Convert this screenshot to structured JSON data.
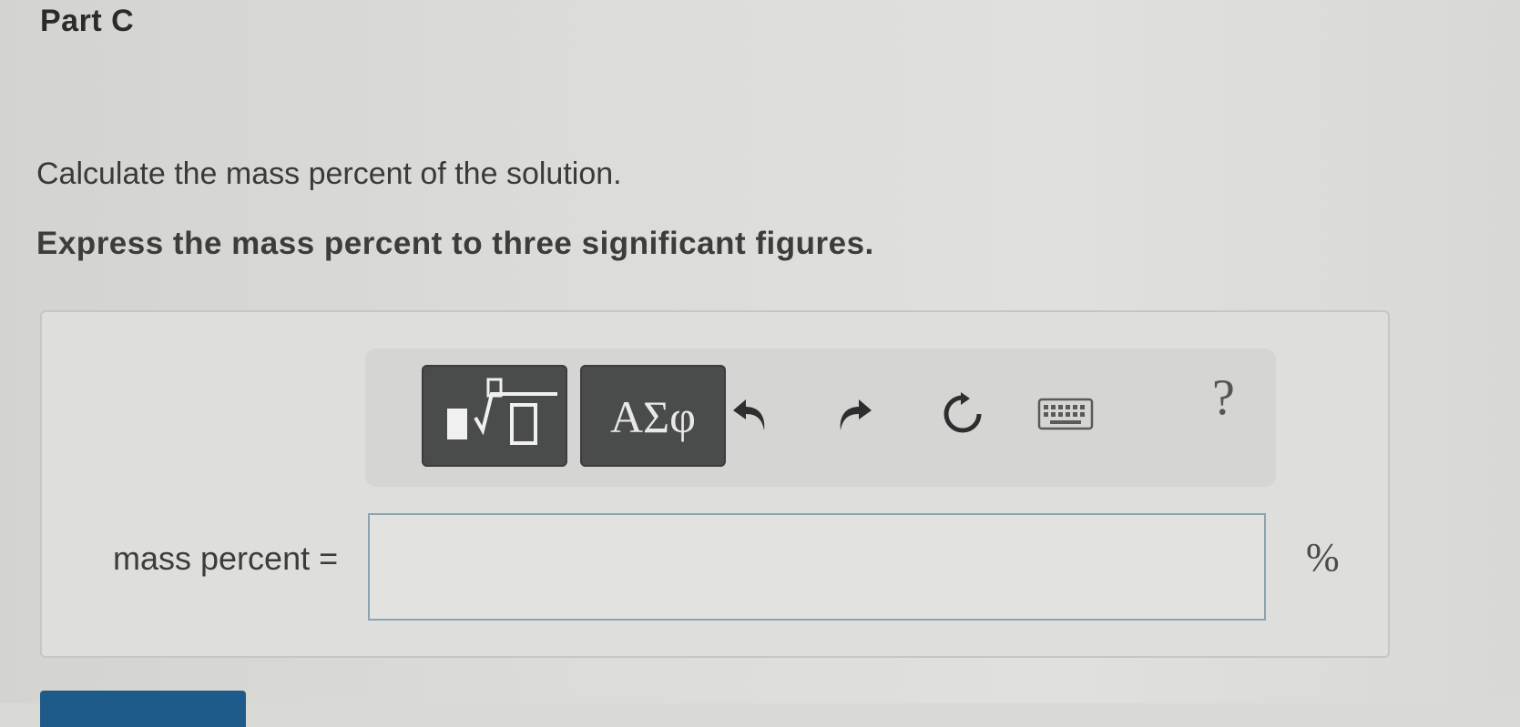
{
  "part": {
    "title": "Part C"
  },
  "question": {
    "instruction": "Calculate the mass percent of the solution.",
    "precision_note": "Express the mass percent to three significant figures."
  },
  "toolbar": {
    "greek_label": "ΑΣφ",
    "help_label": "?",
    "icons": [
      "templates-icon",
      "greek-letters-icon",
      "undo-icon",
      "redo-icon",
      "reset-icon",
      "keyboard-icon",
      "help-icon"
    ]
  },
  "answer": {
    "label": "mass percent =",
    "value": "",
    "unit": "%"
  },
  "colors": {
    "toolbar_button": "#4a4b4b",
    "input_border": "#8aa3b2",
    "submit_button": "#1f5b8a"
  }
}
